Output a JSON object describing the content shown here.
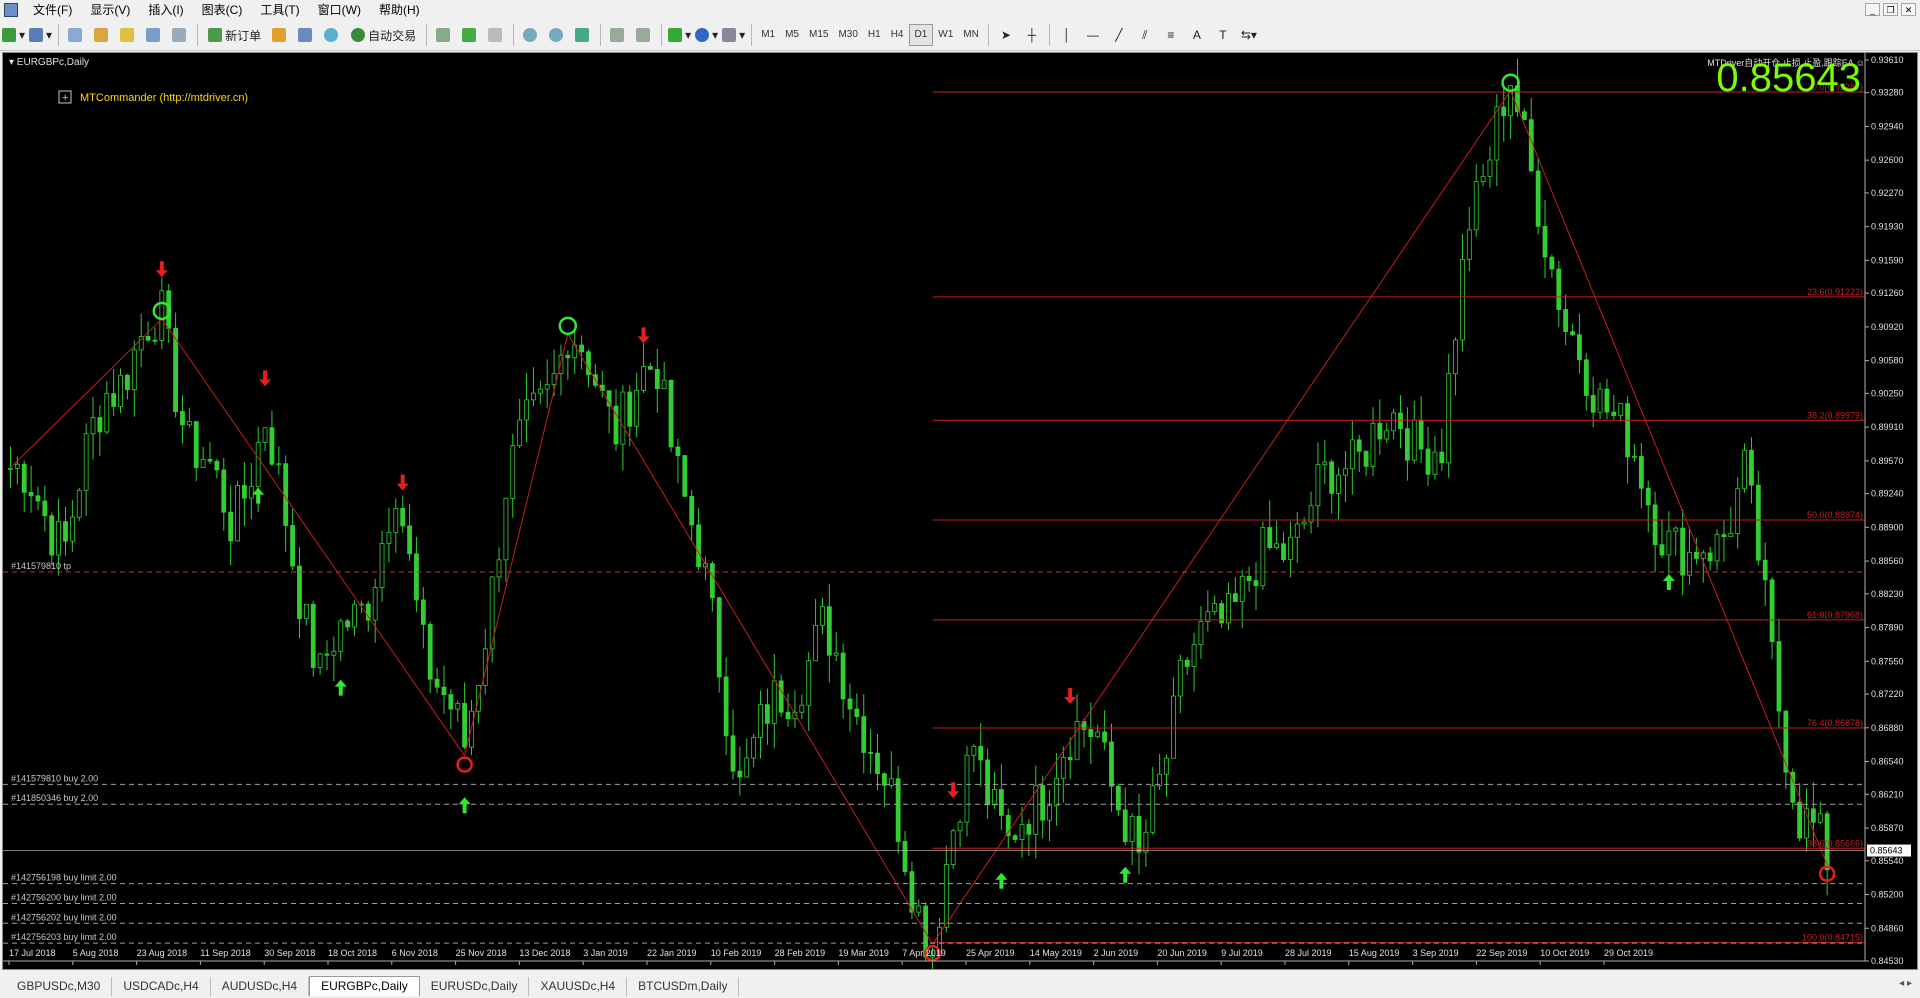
{
  "menu": [
    "文件(F)",
    "显示(V)",
    "插入(I)",
    "图表(C)",
    "工具(T)",
    "窗口(W)",
    "帮助(H)"
  ],
  "toolbar": {
    "new_order": "新订单",
    "auto_trade": "自动交易",
    "timeframes": [
      "M1",
      "M5",
      "M15",
      "M30",
      "H1",
      "H4",
      "D1",
      "W1",
      "MN"
    ],
    "active_timeframe": "D1"
  },
  "chart_data": {
    "type": "candlestick",
    "title": "EURGBPc,Daily",
    "symbol": "EURGBPc",
    "timeframe": "Daily",
    "current_price": "0.85643",
    "bid_label": "0.85643",
    "indicator_label": "MTCommander (http://mtdriver.cn)",
    "ea_label": "MTDriver自动开仓,止损,止盈,跟踪EA ☺",
    "ylim": [
      0.8453,
      0.9368
    ],
    "y_ticks": [
      "0.93610",
      "0.93280",
      "0.92940",
      "0.92600",
      "0.92270",
      "0.91930",
      "0.91590",
      "0.91260",
      "0.90920",
      "0.90580",
      "0.90250",
      "0.89910",
      "0.89570",
      "0.89240",
      "0.88900",
      "0.88560",
      "0.88230",
      "0.87890",
      "0.87550",
      "0.87220",
      "0.86880",
      "0.86540",
      "0.86210",
      "0.85870",
      "0.85540",
      "0.85200",
      "0.84860",
      "0.84530"
    ],
    "x_ticks": [
      "17 Jul 2018",
      "5 Aug 2018",
      "23 Aug 2018",
      "11 Sep 2018",
      "30 Sep 2018",
      "18 Oct 2018",
      "6 Nov 2018",
      "25 Nov 2018",
      "13 Dec 2018",
      "3 Jan 2019",
      "22 Jan 2019",
      "10 Feb 2019",
      "28 Feb 2019",
      "19 Mar 2019",
      "7 Apr 2019",
      "25 Apr 2019",
      "14 May 2019",
      "2 Jun 2019",
      "20 Jun 2019",
      "9 Jul 2019",
      "28 Jul 2019",
      "15 Aug 2019",
      "3 Sep 2019",
      "22 Sep 2019",
      "10 Oct 2019",
      "29 Oct 2019"
    ],
    "zigzag": [
      [
        0,
        0.895
      ],
      [
        22,
        0.91
      ],
      [
        66,
        0.866
      ],
      [
        81,
        0.9085
      ],
      [
        134,
        0.847
      ],
      [
        218,
        0.933
      ],
      [
        264,
        0.855
      ]
    ],
    "price_path": [
      [
        0,
        0.895
      ],
      [
        8,
        0.888
      ],
      [
        14,
        0.903
      ],
      [
        22,
        0.91
      ],
      [
        26,
        0.898
      ],
      [
        32,
        0.89
      ],
      [
        37,
        0.899
      ],
      [
        45,
        0.874
      ],
      [
        52,
        0.883
      ],
      [
        56,
        0.892
      ],
      [
        60,
        0.878
      ],
      [
        66,
        0.866
      ],
      [
        72,
        0.893
      ],
      [
        81,
        0.9085
      ],
      [
        88,
        0.9
      ],
      [
        94,
        0.905
      ],
      [
        100,
        0.886
      ],
      [
        106,
        0.864
      ],
      [
        112,
        0.872
      ],
      [
        118,
        0.878
      ],
      [
        124,
        0.87
      ],
      [
        130,
        0.856
      ],
      [
        134,
        0.847
      ],
      [
        140,
        0.868
      ],
      [
        145,
        0.856
      ],
      [
        152,
        0.866
      ],
      [
        158,
        0.869
      ],
      [
        164,
        0.854
      ],
      [
        170,
        0.874
      ],
      [
        178,
        0.882
      ],
      [
        186,
        0.888
      ],
      [
        194,
        0.896
      ],
      [
        202,
        0.9
      ],
      [
        208,
        0.896
      ],
      [
        212,
        0.921
      ],
      [
        218,
        0.933
      ],
      [
        222,
        0.923
      ],
      [
        226,
        0.908
      ],
      [
        232,
        0.902
      ],
      [
        238,
        0.892
      ],
      [
        244,
        0.885
      ],
      [
        248,
        0.888
      ],
      [
        252,
        0.894
      ],
      [
        256,
        0.876
      ],
      [
        260,
        0.86
      ],
      [
        264,
        0.855
      ]
    ],
    "signals": [
      {
        "i": 22,
        "type": "peak"
      },
      {
        "i": 66,
        "type": "trough"
      },
      {
        "i": 81,
        "type": "peak"
      },
      {
        "i": 134,
        "type": "trough"
      },
      {
        "i": 218,
        "type": "peak"
      },
      {
        "i": 264,
        "type": "trough"
      },
      {
        "i": 22,
        "type": "sell"
      },
      {
        "i": 37,
        "type": "sell"
      },
      {
        "i": 57,
        "type": "sell"
      },
      {
        "i": 92,
        "type": "sell"
      },
      {
        "i": 137,
        "type": "sell"
      },
      {
        "i": 154,
        "type": "sell"
      },
      {
        "i": 218,
        "type": "sell"
      },
      {
        "i": 36,
        "type": "buy"
      },
      {
        "i": 48,
        "type": "buy"
      },
      {
        "i": 66,
        "type": "buy"
      },
      {
        "i": 134,
        "type": "buy"
      },
      {
        "i": 144,
        "type": "buy"
      },
      {
        "i": 162,
        "type": "buy"
      },
      {
        "i": 241,
        "type": "buy"
      }
    ],
    "fib_levels": [
      {
        "label": "0.0(0.93287)",
        "value": 0.93287
      },
      {
        "label": "23.6(0.91222)",
        "value": 0.91222
      },
      {
        "label": "38.2(0.89979)",
        "value": 0.89979
      },
      {
        "label": "50.0(0.88974)",
        "value": 0.88974
      },
      {
        "label": "61.8(0.87968)",
        "value": 0.87968
      },
      {
        "label": "76.4(0.86878)",
        "value": 0.86878
      },
      {
        "label": "98.6(0.85666)",
        "value": 0.85666
      },
      {
        "label": "100.0(0.84715)",
        "value": 0.84715
      }
    ],
    "order_lines": [
      {
        "label": "#141579810 tp",
        "value": 0.8845,
        "color": "#c83232"
      },
      {
        "label": "#141579810 buy 2.00",
        "value": 0.8631,
        "color": "#a0a0a0"
      },
      {
        "label": "#141850346 buy 2.00",
        "value": 0.8611,
        "color": "#a0a0a0"
      },
      {
        "label": "#142756198 buy limit 2.00",
        "value": 0.8531,
        "color": "#a0a0a0"
      },
      {
        "label": "#142756200 buy limit 2.00",
        "value": 0.8511,
        "color": "#a0a0a0"
      },
      {
        "label": "#142756202 buy limit 2.00",
        "value": 0.8491,
        "color": "#a0a0a0"
      },
      {
        "label": "#142756203 buy limit 2.00",
        "value": 0.8471,
        "color": "#a0a0a0"
      }
    ],
    "colors": {
      "background": "#000000",
      "candle": "#32cd32",
      "zigzag": "#c81e1e",
      "fib": "#c81e1e",
      "label": "#c8c8c8",
      "price_big": "#7cfc00",
      "sell": "#e61e1e",
      "buy": "#32e632",
      "indicator_text": "#ffd700"
    }
  },
  "tabs": [
    "GBPUSDc,M30",
    "USDCADc,H4",
    "AUDUSDc,H4",
    "EURGBPc,Daily",
    "EURUSDc,Daily",
    "XAUUSDc,H4",
    "BTCUSDm,Daily"
  ],
  "active_tab": "EURGBPc,Daily"
}
